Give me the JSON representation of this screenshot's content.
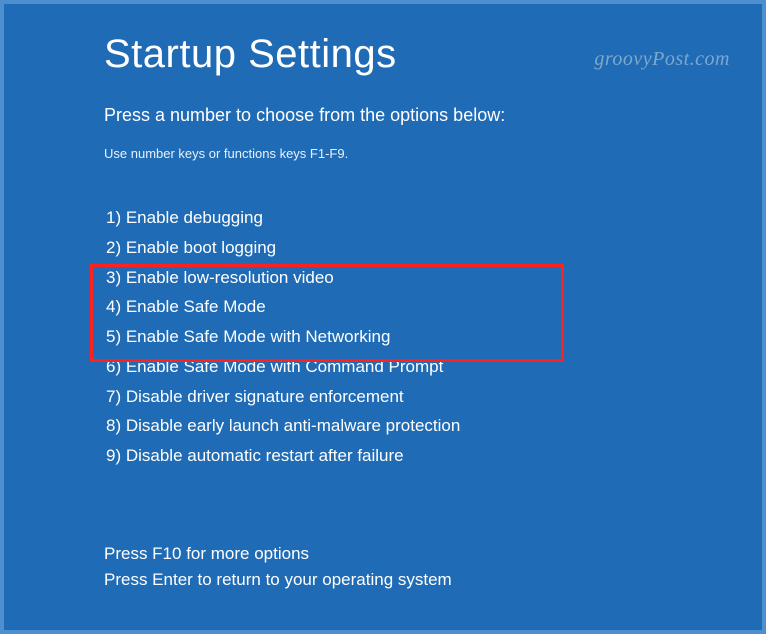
{
  "title": "Startup Settings",
  "subtitle": "Press a number to choose from the options below:",
  "hint": "Use number keys or functions keys F1-F9.",
  "options": [
    "1) Enable debugging",
    "2) Enable boot logging",
    "3) Enable low-resolution video",
    "4) Enable Safe Mode",
    "5) Enable Safe Mode with Networking",
    "6) Enable Safe Mode with Command Prompt",
    "7) Disable driver signature enforcement",
    "8) Disable early launch anti-malware protection",
    "9) Disable automatic restart after failure"
  ],
  "footer": {
    "line1": "Press F10 for more options",
    "line2": "Press Enter to return to your operating system"
  },
  "watermark": "groovyPost.com"
}
